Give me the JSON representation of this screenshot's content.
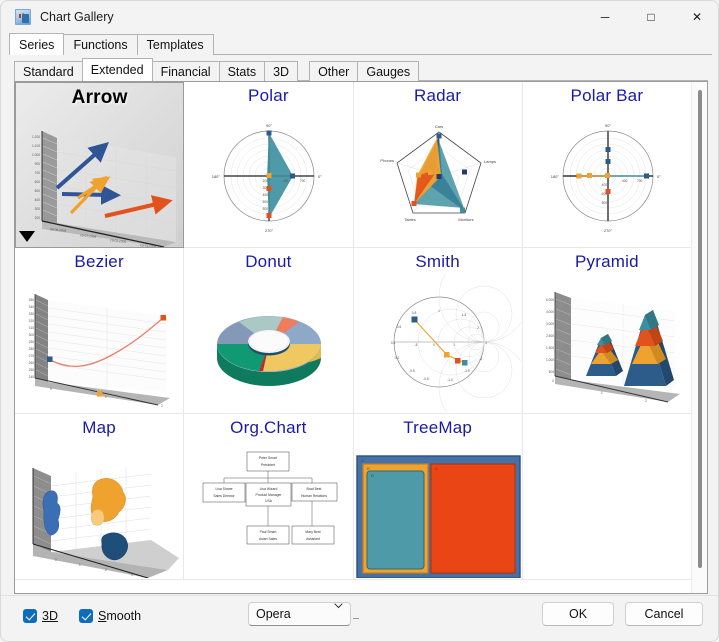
{
  "window": {
    "title": "Chart Gallery",
    "icon": "chart-gallery-icon",
    "minimize": "─",
    "maximize": "□",
    "close": "✕"
  },
  "outer_tabs": [
    {
      "label": "Series",
      "active": true
    },
    {
      "label": "Functions",
      "active": false
    },
    {
      "label": "Templates",
      "active": false
    }
  ],
  "inner_tabs": [
    {
      "label": "Standard",
      "active": false
    },
    {
      "label": "Extended",
      "active": true
    },
    {
      "label": "Financial",
      "active": false
    },
    {
      "label": "Stats",
      "active": false
    },
    {
      "label": "3D",
      "active": false
    },
    {
      "label": "Other",
      "active": false
    },
    {
      "label": "Gauges",
      "active": false
    }
  ],
  "gallery": {
    "items": [
      {
        "title": "Arrow",
        "selected": true,
        "thumb": "arrow"
      },
      {
        "title": "Polar",
        "selected": false,
        "thumb": "polar"
      },
      {
        "title": "Radar",
        "selected": false,
        "thumb": "radar"
      },
      {
        "title": "Polar Bar",
        "selected": false,
        "thumb": "polarbar"
      },
      {
        "title": "Bezier",
        "selected": false,
        "thumb": "bezier"
      },
      {
        "title": "Donut",
        "selected": false,
        "thumb": "donut"
      },
      {
        "title": "Smith",
        "selected": false,
        "thumb": "smith"
      },
      {
        "title": "Pyramid",
        "selected": false,
        "thumb": "pyramid"
      },
      {
        "title": "Map",
        "selected": false,
        "thumb": "map"
      },
      {
        "title": "Org.Chart",
        "selected": false,
        "thumb": "orgchart"
      },
      {
        "title": "TreeMap",
        "selected": false,
        "thumb": "treemap"
      },
      {
        "title": "",
        "selected": false,
        "thumb": "none"
      }
    ],
    "title_color": "#1a1aa8",
    "selected_title_color": "#000000"
  },
  "thumbnails": {
    "polar": {
      "angle_labels": [
        "90°",
        "0°",
        "270°",
        "180°"
      ]
    },
    "radar": {
      "axis_labels": [
        "Cars",
        "Lamps",
        "Monitors",
        "Tables",
        "Phones"
      ]
    },
    "polarbar": {
      "angle_labels": [
        "90°",
        "0°",
        "270°",
        "180°"
      ]
    },
    "orgchart": {
      "nodes": [
        {
          "name": "Peter Smart",
          "role": "President"
        },
        {
          "name": "Lisa Shane",
          "role": "Sales Director"
        },
        {
          "name": "Lisa Wizard",
          "role": "Product Manager",
          "role2": "USA"
        },
        {
          "name": "Brad Best",
          "role": "Human Relations"
        },
        {
          "name": "Paul Smart",
          "role": "Asian Sales"
        },
        {
          "name": "Mary Best",
          "role": "Assistant"
        }
      ]
    },
    "treemap": {
      "labels": [
        "A",
        "B",
        "C",
        "D"
      ],
      "colors": [
        "#4472a8",
        "#f0a22e",
        "#ea4514",
        "#4f9aa8"
      ]
    }
  },
  "bottom_bar": {
    "checkbox_3d": {
      "label": "3D",
      "accel": "3D",
      "checked": true
    },
    "checkbox_smooth": {
      "label": "Smooth",
      "accel": "S",
      "rest": "mooth",
      "checked": true
    },
    "palette_select": {
      "value": "Opera",
      "caret": "⌄"
    },
    "ok_button": "OK",
    "cancel_button": "Cancel"
  },
  "colors": {
    "accent": "#0f6cbd",
    "title_blue": "#1a1aa8",
    "window_bg": "#f3f3f3"
  }
}
